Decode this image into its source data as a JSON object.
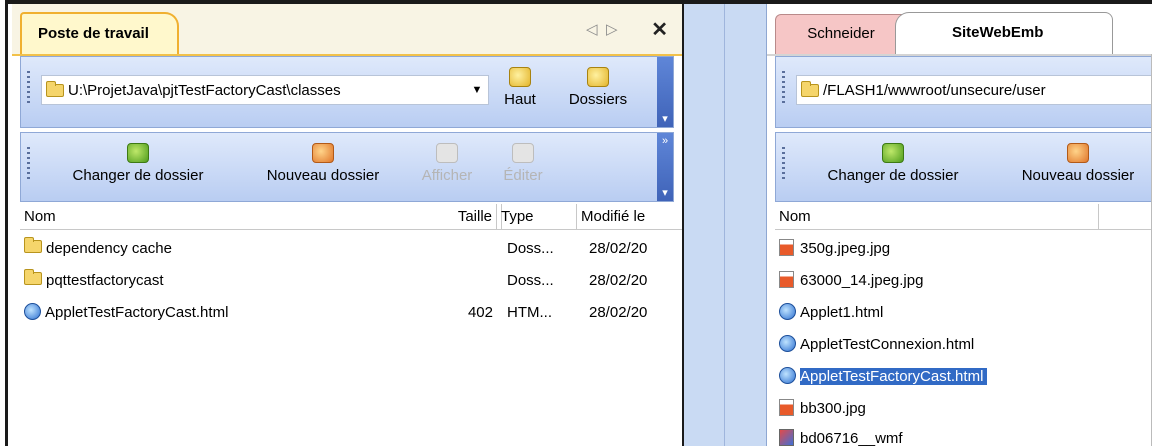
{
  "left_panel": {
    "tab_title": "Poste de travail",
    "nav_prev": "◁",
    "nav_next": "▷",
    "close": "✕",
    "path": "U:\\ProjetJava\\pjtTestFactoryCast\\classes",
    "path_dropdown_arrow": "▼",
    "btn_up": "Haut",
    "btn_folders": "Dossiers",
    "btn_change_folder": "Changer de dossier",
    "btn_new_folder": "Nouveau dossier",
    "btn_view": "Afficher",
    "btn_edit": "Éditer",
    "columns": {
      "name": "Nom",
      "size": "Taille",
      "type": "Type",
      "modified": "Modifié le"
    },
    "rows": [
      {
        "name": "dependency cache",
        "size": "",
        "type": "Doss...",
        "modified": "28/02/20",
        "icon": "folder-icon"
      },
      {
        "name": "pqttestfactorycast",
        "size": "",
        "type": "Doss...",
        "modified": "28/02/20",
        "icon": "folder-icon"
      },
      {
        "name": "AppletTestFactoryCast.html",
        "size": "402",
        "type": "HTM...",
        "modified": "28/02/20",
        "icon": "ie-html-icon"
      }
    ]
  },
  "right_panel": {
    "tab_inactive": "Schneider",
    "tab_active": "SiteWebEmb",
    "path": "/FLASH1/wwwroot/unsecure/user",
    "btn_change_folder": "Changer de dossier",
    "btn_new_folder": "Nouveau dossier",
    "columns": {
      "name": "Nom"
    },
    "rows": [
      {
        "name": "350g.jpeg.jpg",
        "icon": "image-file-icon",
        "selected": false
      },
      {
        "name": "63000_14.jpeg.jpg",
        "icon": "image-file-icon",
        "selected": false
      },
      {
        "name": "Applet1.html",
        "icon": "ie-html-icon",
        "selected": false
      },
      {
        "name": "AppletTestConnexion.html",
        "icon": "ie-html-icon",
        "selected": false
      },
      {
        "name": "AppletTestFactoryCast.html",
        "icon": "ie-html-icon",
        "selected": true
      },
      {
        "name": "bb300.jpg",
        "icon": "image-file-icon",
        "selected": false
      },
      {
        "name": "bd06716__wmf",
        "icon": "wmf-file-icon",
        "selected": false
      }
    ]
  },
  "colors": {
    "selection": "#316ac5",
    "toolbar_blue": "#b9cdf2",
    "tab_yellow_border": "#f0b030",
    "tab_pink": "#f6c6c6"
  }
}
